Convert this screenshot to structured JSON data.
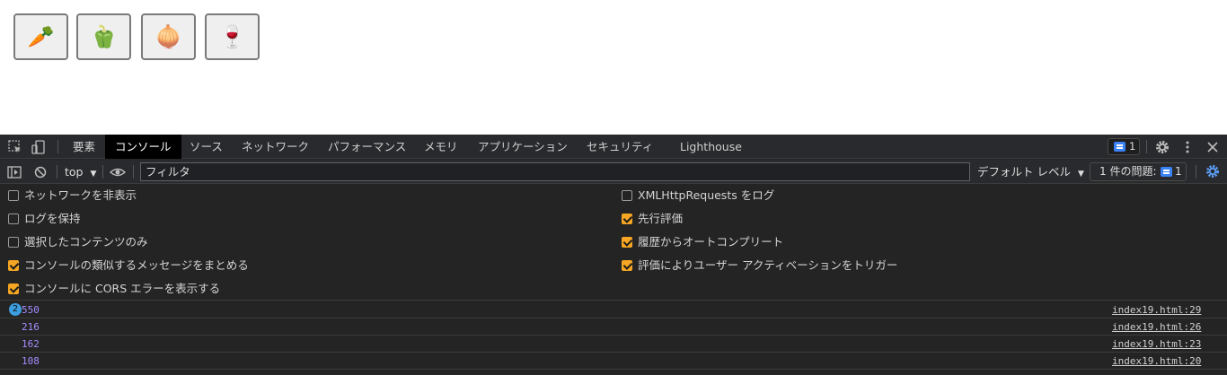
{
  "page": {
    "buttons": [
      {
        "emoji": "🥕",
        "icon": "carrot-icon"
      },
      {
        "emoji": "🫑",
        "icon": "bell-pepper-icon"
      },
      {
        "emoji": "🧅",
        "icon": "onion-icon"
      },
      {
        "emoji": "🍷",
        "icon": "wine-glass-icon"
      }
    ]
  },
  "devtools": {
    "tabs": [
      "要素",
      "コンソール",
      "ソース",
      "ネットワーク",
      "パフォーマンス",
      "メモリ",
      "アプリケーション",
      "セキュリティ",
      "Lighthouse"
    ],
    "active_tab": "コンソール",
    "issues_badge_count": "1",
    "toolbar": {
      "context": "top",
      "filter_placeholder": "フィルタ",
      "level": "デフォルト レベル",
      "issue_counter_label": "1 件の問題:",
      "issue_counter_count": "1"
    },
    "settings_left": [
      {
        "label": "ネットワークを非表示",
        "checked": false
      },
      {
        "label": "ログを保持",
        "checked": false
      },
      {
        "label": "選択したコンテンツのみ",
        "checked": false
      },
      {
        "label": "コンソールの類似するメッセージをまとめる",
        "checked": true
      },
      {
        "label": "コンソールに CORS エラーを表示する",
        "checked": true
      }
    ],
    "settings_right": [
      {
        "label": "XMLHttpRequests をログ",
        "checked": false
      },
      {
        "label": "先行評価",
        "checked": true
      },
      {
        "label": "履歴からオートコンプリート",
        "checked": true
      },
      {
        "label": "評価によりユーザー アクティベーションをトリガー",
        "checked": true
      }
    ],
    "messages": [
      {
        "repeat": "2",
        "value": "550",
        "source": "index19.html:29"
      },
      {
        "repeat": "",
        "value": "216",
        "source": "index19.html:26"
      },
      {
        "repeat": "",
        "value": "162",
        "source": "index19.html:23"
      },
      {
        "repeat": "",
        "value": "108",
        "source": "index19.html:20"
      }
    ],
    "colors": {
      "accent_checkbox": "#f5a623",
      "number_value": "#a58cff",
      "badge_blue": "#3b82f6"
    }
  }
}
